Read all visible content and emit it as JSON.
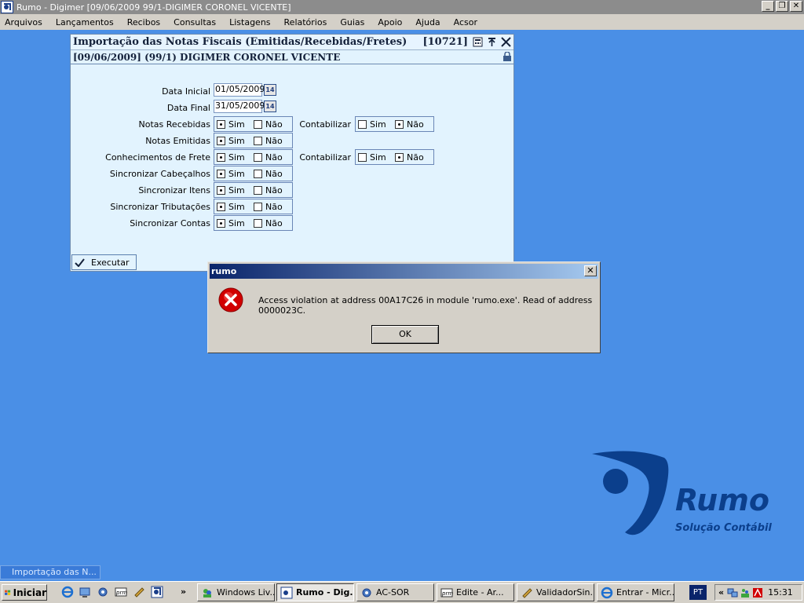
{
  "app": {
    "title": "Rumo - Digimer [09/06/2009 99/1-DIGIMER CORONEL VICENTE]"
  },
  "menu": [
    "Arquivos",
    "Lançamentos",
    "Recibos",
    "Consultas",
    "Listagens",
    "Relatórios",
    "Guias",
    "Apoio",
    "Ajuda",
    "Acsor"
  ],
  "form": {
    "title": "Importação das Notas Fiscais (Emitidas/Recebidas/Fretes)",
    "code": "[10721]",
    "subtitle": "[09/06/2009] (99/1) DIGIMER CORONEL VICENTE",
    "data_inicial_label": "Data Inicial",
    "data_inicial_value": "01/05/2009",
    "data_final_label": "Data Final",
    "data_final_value": "31/05/2009",
    "cal_label": "14",
    "sim": "Sim",
    "nao": "Não",
    "contabilizar_label": "Contabilizar",
    "rows": [
      {
        "label": "Notas Recebidas",
        "value": "Sim",
        "contabilizar": "Não"
      },
      {
        "label": "Notas Emitidas",
        "value": "Sim"
      },
      {
        "label": "Conhecimentos de Frete",
        "value": "Sim",
        "contabilizar": "Não"
      },
      {
        "label": "Sincronizar Cabeçalhos",
        "value": "Sim"
      },
      {
        "label": "Sincronizar Itens",
        "value": "Sim"
      },
      {
        "label": "Sincronizar Tributações",
        "value": "Sim"
      },
      {
        "label": "Sincronizar Contas",
        "value": "Sim"
      }
    ],
    "execute_label": "Executar"
  },
  "dialog": {
    "title": "rumo",
    "message": "Access violation at address 00A17C26 in module 'rumo.exe'. Read of address 0000023C.",
    "ok_label": "OK"
  },
  "logo": {
    "name": "Rumo",
    "tagline": "Solução Contábil",
    "color": "#0b3f8c"
  },
  "minimized": {
    "label": "Importação das N..."
  },
  "taskbar": {
    "start_label": "Iniciar",
    "tasks": [
      "Windows Liv...",
      "Rumo - Dig...",
      "AC-SOR",
      "Edite - Ar...",
      "ValidadorSin...",
      "Entrar - Micr..."
    ],
    "lang": "PT",
    "expand": "«",
    "clock": "15:31"
  }
}
